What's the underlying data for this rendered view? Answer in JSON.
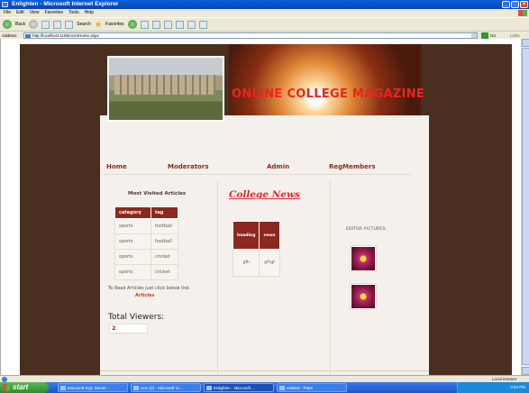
{
  "window": {
    "title": "Enlighten - Microsoft Internet Explorer"
  },
  "menu": [
    "File",
    "Edit",
    "View",
    "Favorites",
    "Tools",
    "Help"
  ],
  "toolbar": {
    "back": "Back",
    "search": "Search",
    "favorites": "Favorites"
  },
  "address": {
    "label": "Address",
    "url": "http://localhost:1165/ocm/Home.aspx",
    "go": "Go",
    "links": "Links"
  },
  "header": {
    "title": "ONLINE COLLEGE MAGAZINE"
  },
  "nav": {
    "home": "Home",
    "moderators": "Moderators",
    "admin": "Admin",
    "regmembers": "RegMembers"
  },
  "most_visited": {
    "title": "Most Visited Articles",
    "headers": [
      "category",
      "tag"
    ],
    "rows": [
      [
        "sports",
        "football"
      ],
      [
        "sports",
        "football"
      ],
      [
        "sports",
        "cricket"
      ],
      [
        "sports",
        "cricket"
      ]
    ]
  },
  "read": {
    "text": "To Read Articles just click below link",
    "link": "Articles"
  },
  "viewers": {
    "label": "Total Viewers:",
    "value": "2"
  },
  "college_news": {
    "title": "College News",
    "headers": [
      "heading",
      "news"
    ],
    "rows": [
      [
        "gfh",
        "gfhgf"
      ]
    ]
  },
  "editor": {
    "label": "EDITOR PICTURES:"
  },
  "status": {
    "zone": "Local intranet"
  },
  "taskbar": {
    "start": "start",
    "tasks": [
      "Microsoft SQL Server ...",
      "ocm (2) - Microsoft Vi...",
      "Enlighten - Microsoft ...",
      "untitled - Paint"
    ],
    "clock": "3:52 PM"
  }
}
